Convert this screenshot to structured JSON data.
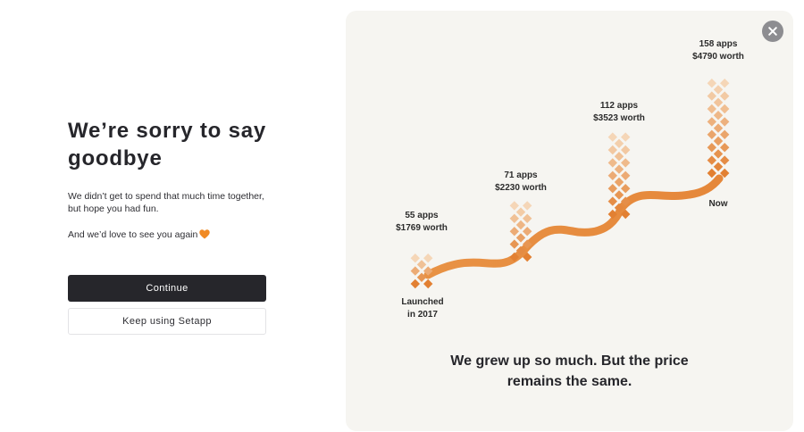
{
  "modal": {
    "title_line1": "We’re sorry to say",
    "title_line2": "goodbye",
    "paragraph1": "We didn’t get to spend that much time together, but hope you had fun.",
    "paragraph2": "And we’d love to see you again",
    "heart_icon": "orange-heart-icon",
    "continue_label": "Continue",
    "keep_label": "Keep using Setapp"
  },
  "panel": {
    "close_icon": "close-icon",
    "tagline_line1": "We grew up so much. But the price",
    "tagline_line2": "remains the same.",
    "milestones": [
      {
        "apps": "55 apps",
        "worth": "$1769 worth",
        "caption_line1": "Launched",
        "caption_line2": "in 2017"
      },
      {
        "apps": "71 apps",
        "worth": "$2230 worth"
      },
      {
        "apps": "112 apps",
        "worth": "$3523 worth"
      },
      {
        "apps": "158 apps",
        "worth": "$4790 worth",
        "caption_line1": "Now"
      }
    ]
  },
  "colors": {
    "accent": "#e8863a",
    "dark_button": "#26262b",
    "panel_bg": "#f6f5f1",
    "close_bg": "#8d8d91"
  }
}
